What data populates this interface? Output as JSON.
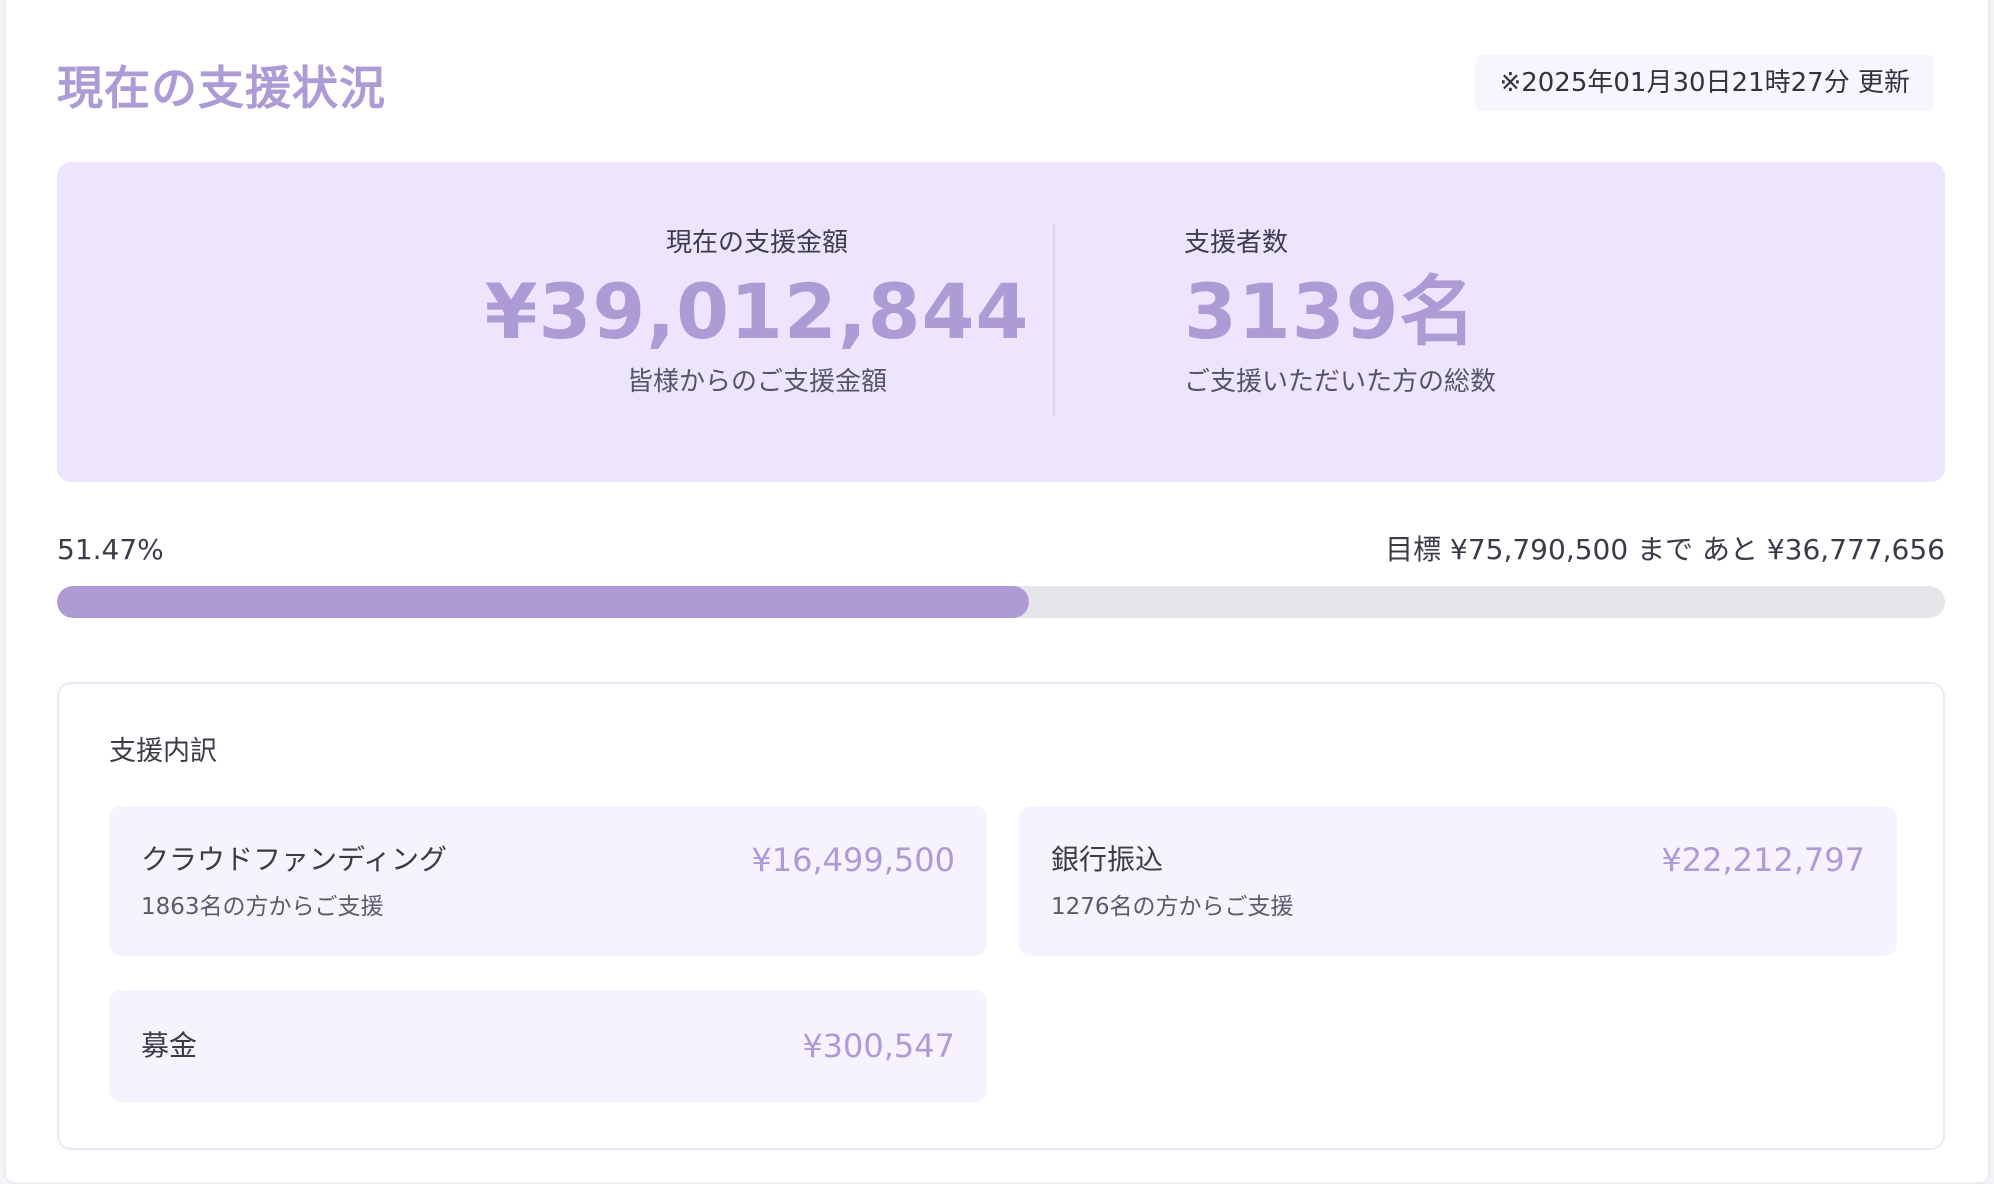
{
  "page": {
    "title": "現在の支援状況",
    "updated": "※2025年01月30日21時27分 更新"
  },
  "summary": {
    "amount": {
      "label": "現在の支援金額",
      "value": "¥39,012,844",
      "sub": "皆様からのご支援金額"
    },
    "supporters": {
      "label": "支援者数",
      "value": "3139名",
      "sub": "ご支援いただいた方の総数"
    }
  },
  "progress": {
    "percent_label": "51.47%",
    "percent": 51.47,
    "goal_text": "目標 ¥75,790,500 まで あと ¥36,777,656"
  },
  "breakdown": {
    "title": "支援内訳",
    "items": [
      {
        "name": "クラウドファンディング",
        "amount": "¥16,499,500",
        "note": "1863名の方からご支援"
      },
      {
        "name": "銀行振込",
        "amount": "¥22,212,797",
        "note": "1276名の方からご支援"
      },
      {
        "name": "募金",
        "amount": "¥300,547"
      }
    ]
  },
  "colors": {
    "accent": "#ad9bd6",
    "summary_bg": "#ede5fd",
    "item_bg": "#f6f3fe",
    "track": "#e5e5ea"
  }
}
